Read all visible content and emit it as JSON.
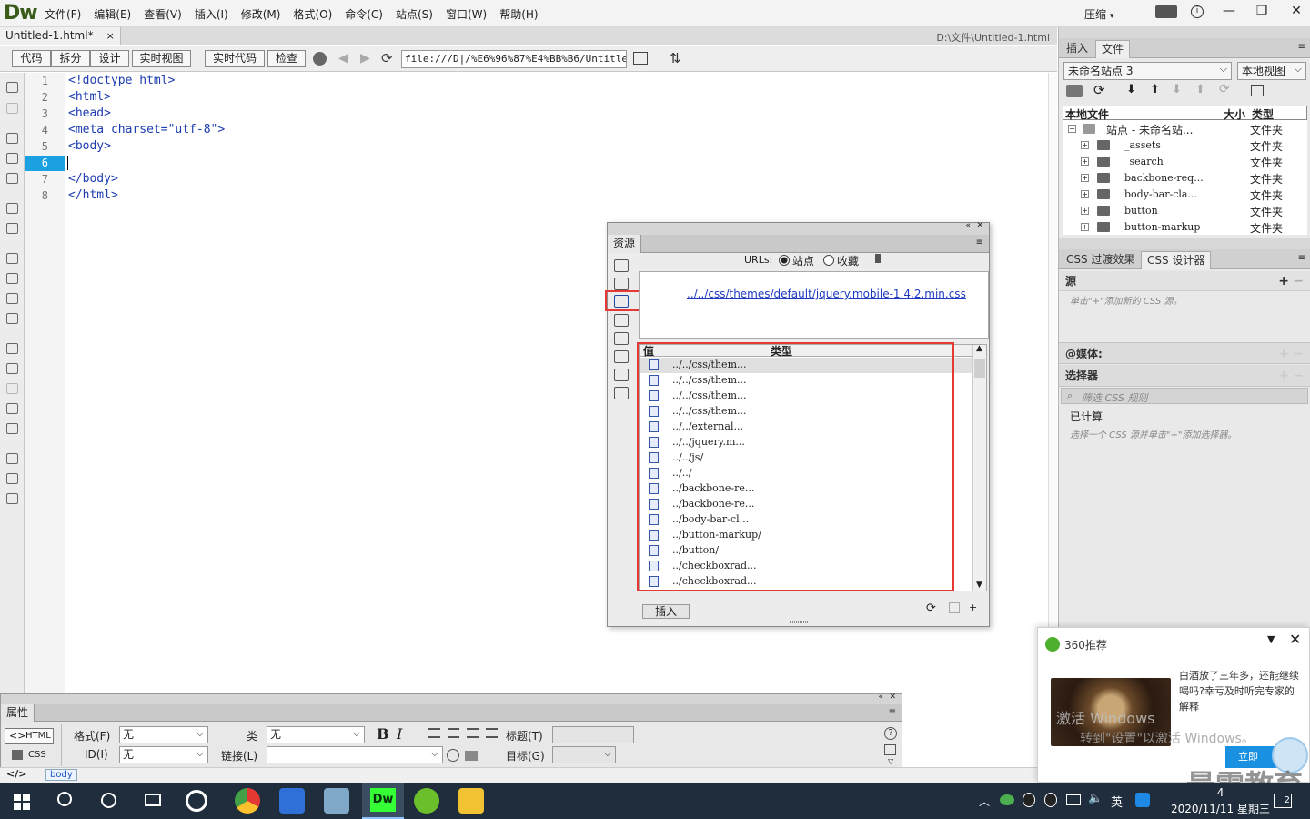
{
  "app": {
    "logo": "Dw"
  },
  "menubar": {
    "items": [
      "文件(F)",
      "编辑(E)",
      "查看(V)",
      "插入(I)",
      "修改(M)",
      "格式(O)",
      "命令(C)",
      "站点(S)",
      "窗口(W)",
      "帮助(H)"
    ],
    "compress_label": "压缩",
    "window_controls": [
      "—",
      "❐",
      "✕"
    ]
  },
  "document": {
    "tab_name": "Untitled-1.html*",
    "tab_close": "×",
    "path": "D:\\文件\\Untitled-1.html",
    "view_buttons": [
      "代码",
      "拆分",
      "设计",
      "实时视图"
    ],
    "live_code": "实时代码",
    "inspect": "检查",
    "url": "file:///D|/%E6%96%87%E4%BB%B6/Untitled",
    "lines": [
      {
        "n": "1",
        "t": "<!doctype html>"
      },
      {
        "n": "2",
        "t": "<html>"
      },
      {
        "n": "3",
        "t": "<head>"
      },
      {
        "n": "4",
        "t": "<meta charset=\"utf-8\">"
      },
      {
        "n": "5",
        "t": "<body>"
      },
      {
        "n": "6",
        "t": ""
      },
      {
        "n": "7",
        "t": "</body>"
      },
      {
        "n": "8",
        "t": "</html>"
      }
    ],
    "current_line": "6"
  },
  "files_panel": {
    "tabs": [
      "插入",
      "文件"
    ],
    "site": "未命名站点 3",
    "view": "本地视图",
    "headers": {
      "name": "本地文件",
      "size": "大小",
      "type": "类型"
    },
    "root": {
      "name": "站点 - 未命名站...",
      "type": "文件夹"
    },
    "rows": [
      {
        "name": "_assets",
        "type": "文件夹"
      },
      {
        "name": "_search",
        "type": "文件夹"
      },
      {
        "name": "backbone-req...",
        "type": "文件夹"
      },
      {
        "name": "body-bar-cla...",
        "type": "文件夹"
      },
      {
        "name": "button",
        "type": "文件夹"
      },
      {
        "name": "button-markup",
        "type": "文件夹"
      }
    ]
  },
  "css_panel": {
    "tabs": [
      "CSS 过渡效果",
      "CSS 设计器"
    ],
    "source_label": "源",
    "source_hint": "单击\"+\"添加新的 CSS 源。",
    "media_label": "@媒体:",
    "selector_label": "选择器",
    "filter_placeholder": "筛选 CSS 规则",
    "computed_label": "已计算",
    "computed_hint": "选择一个 CSS 源并单击\"+\"添加选择器。"
  },
  "assets_panel": {
    "title": "资源",
    "urls_label": "URLs:",
    "radio_site": "站点",
    "radio_fav": "收藏",
    "preview_link": "../../css/themes/default/jquery.mobile-1.4.2.min.css",
    "col_value": "值",
    "col_type": "类型",
    "rows": [
      "../../css/them...",
      "../../css/them...",
      "../../css/them...",
      "../../css/them...",
      "../../external...",
      "../../jquery.m...",
      "../../js/",
      "../../",
      "../backbone-re...",
      "../backbone-re...",
      "../body-bar-cl...",
      "../button-markup/",
      "../button/",
      "../checkboxrad...",
      "../checkboxrad..."
    ],
    "insert_label": "插入"
  },
  "properties": {
    "title": "属性",
    "html_btn": "HTML",
    "css_btn": "CSS",
    "format_label": "格式(F)",
    "format_value": "无",
    "class_label": "类",
    "class_value": "无",
    "id_label": "ID(I)",
    "id_value": "无",
    "link_label": "链接(L)",
    "title_label": "标题(T)",
    "target_label": "目标(G)",
    "bold": "B",
    "italic": "I"
  },
  "tag_selector": {
    "code_icon": "</>",
    "tag": "body"
  },
  "popup": {
    "title": "360推荐",
    "text": "白酒放了三年多，还能继续喝吗?幸亏及时听完专家的解释",
    "activate1": "激活 Windows",
    "activate2": "转到\"设置\"以激活 Windows。",
    "button": "立即"
  },
  "taskbar": {
    "ime": "英",
    "time": "4",
    "date": "2020/11/11 星期三",
    "notify_count": "2"
  },
  "watermark": "最需教育"
}
